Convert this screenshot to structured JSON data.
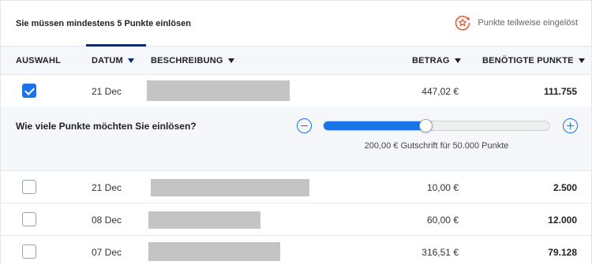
{
  "header": {
    "title": "Sie müssen mindestens 5 Punkte einlösen",
    "status_text": "Punkte teilweise eingelöst",
    "status_icon": "star-refresh-icon",
    "accent_color": "#e8562a"
  },
  "table": {
    "columns": {
      "select": "AUSWAHL",
      "date": "DATUM",
      "description": "BESCHREIBUNG",
      "amount": "BETRAG",
      "points": "BENÖTIGTE PUNKTE"
    },
    "sorted_column": "date",
    "rows": [
      {
        "checked": true,
        "date": "21 Dec",
        "amount": "447,02 €",
        "points": "111.755"
      },
      {
        "checked": false,
        "date": "21 Dec",
        "amount": "10,00 €",
        "points": "2.500"
      },
      {
        "checked": false,
        "date": "08 Dec",
        "amount": "60,00 €",
        "points": "12.000"
      },
      {
        "checked": false,
        "date": "07 Dec",
        "amount": "316,51 €",
        "points": "79.128"
      }
    ]
  },
  "redeem_panel": {
    "question": "Wie viele Punkte möchten Sie einlösen?",
    "credit_text": "200,00 € Gutschrift für 50.000 Punkte",
    "slider_fraction": 0.45,
    "minus_icon": "minus-circle-icon",
    "plus_icon": "plus-circle-icon",
    "accent_color": "#1a73e8"
  }
}
